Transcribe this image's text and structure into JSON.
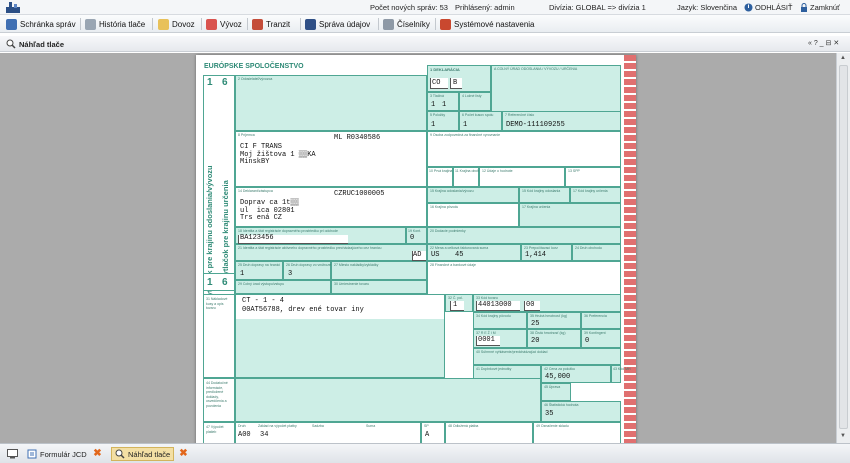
{
  "topbar": {
    "new_messages": "Počet nových správ: 53",
    "logged_in": "Prihlásený: admin",
    "division": "Divízia: GLOBAL => divízia 1",
    "language": "Jazyk: Slovenčina",
    "logout": "ODHLÁSIŤ",
    "lock": "Zamknúť"
  },
  "menu": {
    "items": [
      "Schránka správ",
      "História tlače",
      "Dovoz",
      "Vývoz",
      "Tranzit",
      "Správa údajov",
      "Číselníky",
      "Systémové nastavenia"
    ]
  },
  "panel": {
    "title": "Náhľad tlače",
    "controls": "« ? _ ⊟ ✕"
  },
  "form": {
    "header": "EURÓPSKE SPOLOČENSTVO",
    "side_top": "Vytlačok pre krajinu odoslania/vývozu",
    "side_bottom": "Vytlačok pre krajinu určenia",
    "digit_1": "1",
    "digit_6": "6",
    "declaration_label": "1 DEKLARÁCIA",
    "declaration_code": "CO",
    "declaration_type": "B",
    "customs_office_label": "A COLNÝ ÚRAD ODOSLANIA / VÝVOZU / URČENIA",
    "consignor_label": "2 Odosielateľ/vývozca",
    "forms_label": "3 Tlačivá",
    "forms_a": "1",
    "forms_b": "1",
    "loading_lists_label": "4 Ložné listy",
    "items_label": "5 Položky",
    "items_value": "1",
    "packages_label": "6 Počet kusov spolu",
    "packages_value": "1",
    "reference_label": "7 Referenčné číslo",
    "reference_value": "DEMO-111109255",
    "consignee_label": "8 Príjemca",
    "consignee_id": "ML R0340586",
    "consignee_lines": "CI F TRANS\nMoj žištova 1 ▒▒KA\nMinskBY",
    "financial_label": "9 Osoba zodpovedná za finančné vyrovnanie",
    "country_first_label": "10 Prvá krajina určenia",
    "trading_label": "11 Krajina obchodovania",
    "value_details_label": "12 Údaje o hodnote",
    "cap_label": "13 SPP",
    "declarant_label": "14 Deklarant/zástupca",
    "declarant_id": "CZRUC1000005",
    "declarant_lines": "Doprav ca 1t▒▒\nul  ica 02801\nTrs ená CZ",
    "dispatch_country_label": "15 Krajina odoslania/vývozu",
    "dispatch_code_label": "15 Kód krajiny odoslania",
    "dest_code_label": "17 Kód krajiny určenia",
    "origin_label": "16 Krajina pôvodu",
    "dest_country_label": "17 Krajina určenia",
    "transport_id_label": "18 Identita a štát registrácie dopravného prostriedku pri odchode",
    "transport_id": "BA123456",
    "container_label": "19 Kont.",
    "container_value": "0",
    "delivery_label": "20 Dodacie podmienky",
    "border_transport_label": "21 Identita a štát registrácie aktívneho dopravného prostriedku prechádzajúceho cez hranicu",
    "border_country": "AD",
    "currency_label": "22 Mena a celková fakturovaná suma",
    "currency": "US",
    "currency_amount": "45",
    "exchange_label": "23 Prepočítavací kurz",
    "exchange_value": "1,414",
    "transaction_label": "24 Druh obchodu",
    "mode_border_label": "25 Druh dopravy na hranici",
    "mode_border_value": "1",
    "mode_inland_label": "26 Druh dopravy vo vnútrozemí",
    "mode_inland_value": "3",
    "loading_place_label": "27 Miesto nakládky/vykládky",
    "financial_data_label": "28 Finančné a bankové údaje",
    "exit_office_label": "29 Colný úrad výstupu/vstupu",
    "goods_location_label": "30 Umiestnenie tovaru",
    "packages_desc_label": "31 Nákladové kusy a opis tovaru",
    "marks_line_1": "CT - 1 - 4",
    "marks_line_2": "00AT56788, drev ené tovar iny",
    "item_no_label": "32 Č. pol.",
    "item_no": "1",
    "commodity_label": "33 Kód tovaru",
    "commodity_code": "44013000",
    "commodity_suffix": "00",
    "origin_code_label": "34 Kód krajiny pôvodu",
    "gross_label": "35 Hrubá hmotnosť (kg)",
    "gross_value": "25",
    "preference_label": "36 Preferencia",
    "procedure_label": "37 R E Ž I M",
    "procedure_value": "0001",
    "net_label": "38 Čistá hmotnosť (kg)",
    "net_value": "20",
    "quota_label": "39 Kontingent",
    "quota_value": "0",
    "summary_label": "40 Súhrnné vyhlásenie/predchádzajúci doklad",
    "supp_units_label": "41 Doplnkové jednotky",
    "item_price_label": "42 Cena za položku",
    "item_price": "45,000",
    "valuation_label": "43 Kód MH",
    "docs_label": "44 Dodatočné informácie, predložené doklady, osvedčenia a povolenia",
    "adjustment_label": "45 Úprava",
    "stat_value_label": "46 Štatistická hodnota",
    "stat_value": "35",
    "calc_label": "47 Výpočet platieb",
    "calc_type": "A00",
    "calc_base": "34",
    "calc_h1": "Druh",
    "calc_h2": "Základ na výpočet platby",
    "calc_h3": "Sadzba",
    "calc_h4": "Suma",
    "calc_h5": "SP",
    "calc_sp": "A",
    "deferred_label": "48 Odložená platba",
    "warehouse_label": "49 Označenie skladu"
  },
  "tabs": [
    "Formulár JCD",
    "Náhľad tlače"
  ]
}
